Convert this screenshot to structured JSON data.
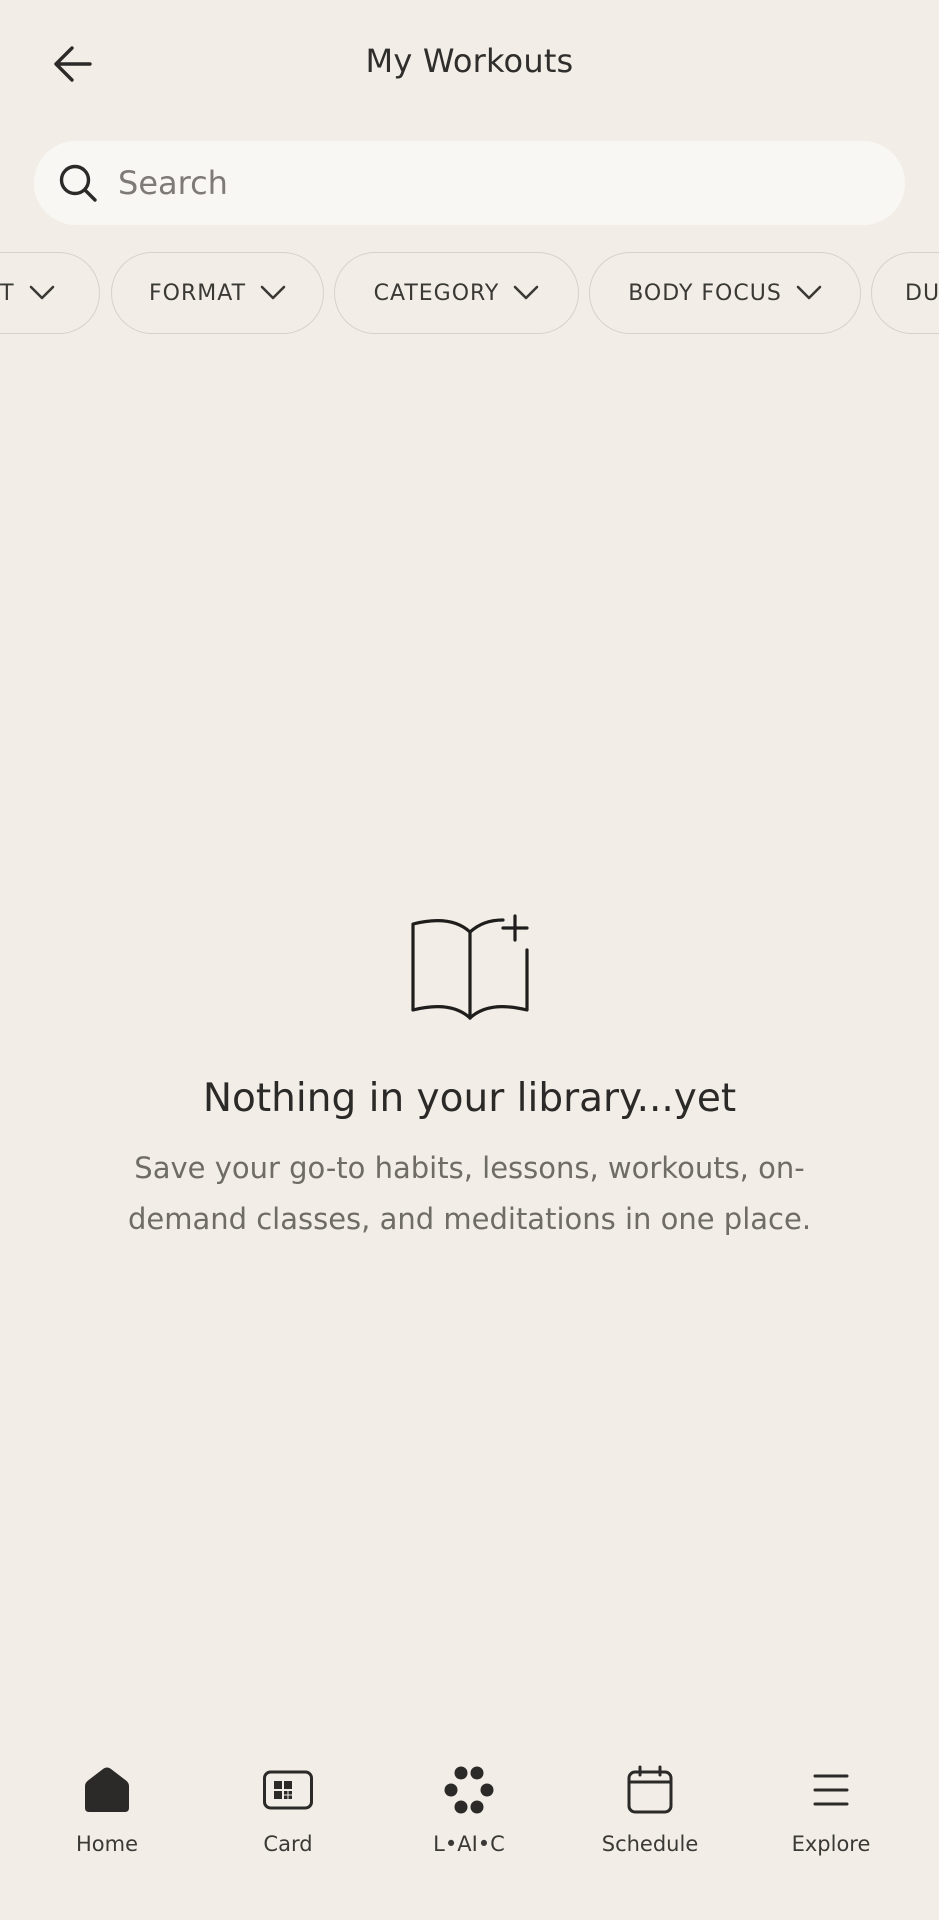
{
  "header": {
    "title": "My Workouts"
  },
  "search": {
    "placeholder": "Search"
  },
  "filters": [
    {
      "label": "RT"
    },
    {
      "label": "FORMAT"
    },
    {
      "label": "CATEGORY"
    },
    {
      "label": "BODY FOCUS"
    },
    {
      "label": "DU"
    }
  ],
  "empty_state": {
    "title": "Nothing in your library...yet",
    "description": "Save your go-to habits, lessons, workouts, on-demand classes, and meditations in one place."
  },
  "nav": {
    "items": [
      {
        "label": "Home",
        "icon": "home-icon"
      },
      {
        "label": "Card",
        "icon": "card-icon"
      },
      {
        "label": "L•AI•C",
        "icon": "dots-icon"
      },
      {
        "label": "Schedule",
        "icon": "calendar-icon"
      },
      {
        "label": "Explore",
        "icon": "menu-icon"
      }
    ]
  },
  "colors": {
    "background": "#f2eee7",
    "search_bg": "#f8f7f3",
    "text": "#2b2a28",
    "muted_text": "#6f6c67",
    "chip_border": "#d6d2cb"
  }
}
